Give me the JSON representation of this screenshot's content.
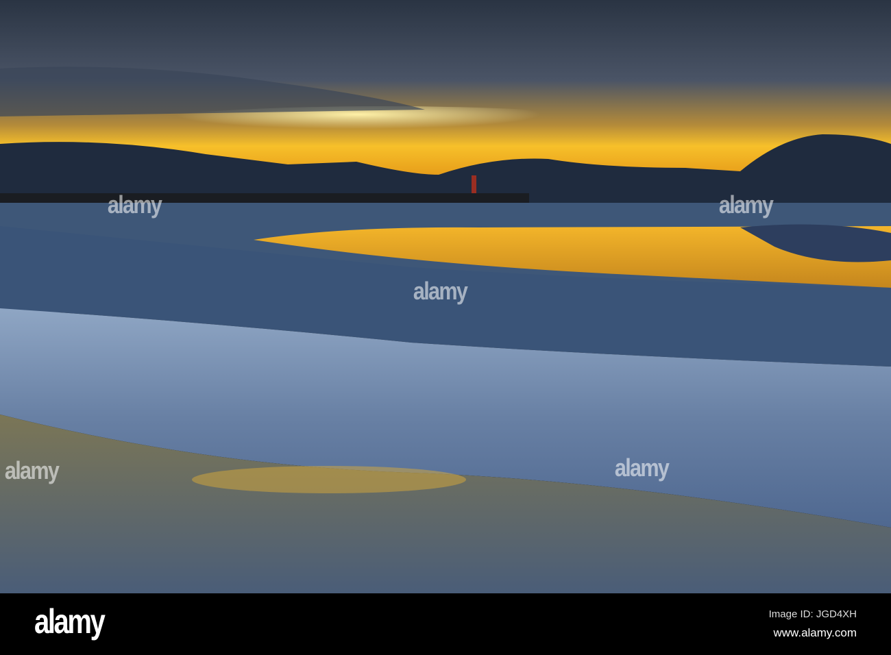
{
  "image": {
    "subject": "sunset-over-tidal-estuary",
    "colors": {
      "sky_top": "#2c3a4c",
      "sun_glow": "#f6b21c",
      "hills": "#1e2a3c",
      "water": "#5a7396",
      "mud": "#3c5572"
    }
  },
  "watermark": {
    "text": "alamy"
  },
  "footer": {
    "logo": "alamy",
    "image_id": "Image ID: JGD4XH",
    "website": "www.alamy.com"
  }
}
